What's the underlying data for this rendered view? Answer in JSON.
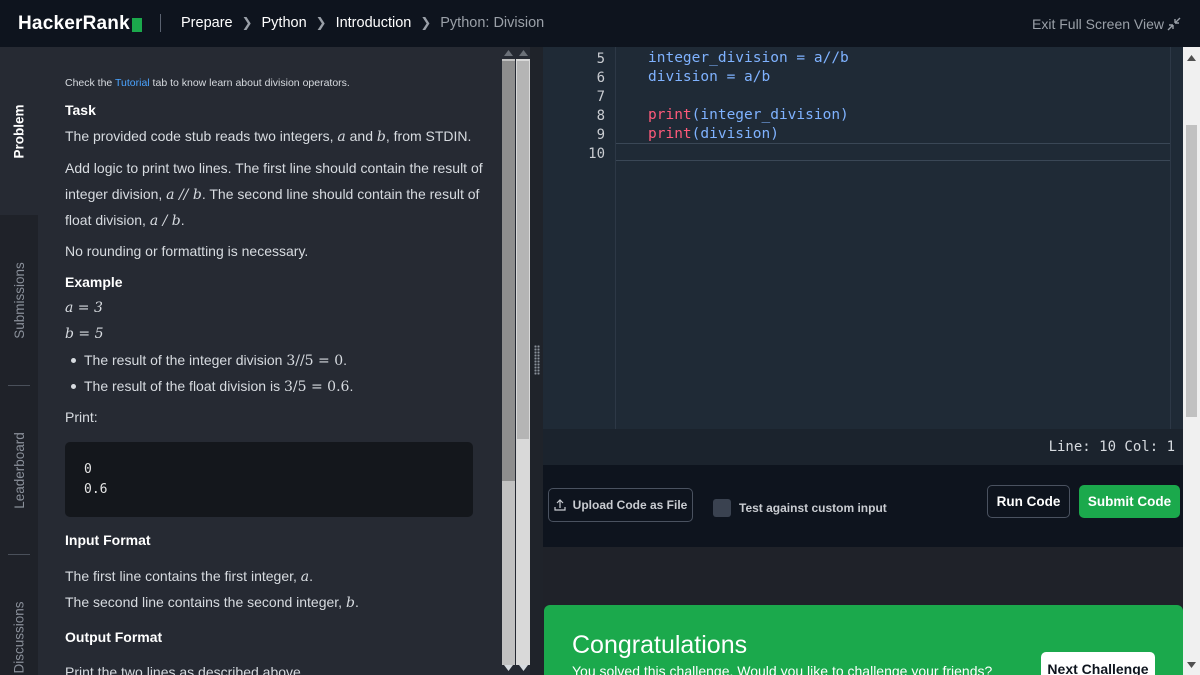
{
  "header": {
    "logo_text": "HackerRank",
    "breadcrumbs": [
      "Prepare",
      "Python",
      "Introduction",
      "Python: Division"
    ],
    "exit_fullscreen": "Exit Full Screen View"
  },
  "side_tabs": [
    "Problem",
    "Submissions",
    "Leaderboard",
    "Discussions"
  ],
  "problem": {
    "note_pre": "Check the ",
    "note_link": "Tutorial",
    "note_post": " tab to know learn about division operators.",
    "task_heading": "Task",
    "task_text_pre": "The provided code stub reads two integers, ",
    "var_a": "a",
    "task_and": " and ",
    "var_b": "b",
    "task_text_post": ", from STDIN.",
    "logic_line1": "Add logic to print two lines. The first line should contain the result of",
    "logic_line2_pre": "integer division, ",
    "int_div_expr": "a // b",
    "logic_line2_post": ". The second line should contain the result of",
    "logic_line3_pre": "float division, ",
    "float_div_expr": "a / b",
    "logic_line3_post": ".",
    "no_rounding": "No rounding or formatting is necessary.",
    "example_heading": "Example",
    "example_a": "a = 3",
    "example_b": "b = 5",
    "bullet1_pre": "The result of the integer division ",
    "bullet1_expr": "3//5 = 0",
    "bullet1_post": ".",
    "bullet2_pre": "The result of the float division is ",
    "bullet2_expr": "3/5 = 0.6",
    "bullet2_post": ".",
    "print_label": "Print:",
    "output_lines": [
      "0",
      "0.6"
    ],
    "input_heading": "Input Format",
    "input_line1_pre": "The first line contains the first integer, ",
    "input_line1_var": "a",
    "input_line1_post": ".",
    "input_line2_pre": "The second line contains the second integer, ",
    "input_line2_var": "b",
    "input_line2_post": ".",
    "output_heading": "Output Format",
    "output_text": "Print the two lines as described above."
  },
  "editor": {
    "line_numbers": [
      "5",
      "6",
      "7",
      "8",
      "9",
      "10"
    ],
    "line5": "integer_division = a//b",
    "line6": "division = a/b",
    "line8_kw": "print",
    "line8_rest": "(integer_division)",
    "line9_kw": "print",
    "line9_rest": "(division)",
    "status": "Line: 10 Col: 1"
  },
  "toolbar": {
    "upload_label": "Upload Code as File",
    "custom_input_label": "Test against custom input",
    "run_label": "Run Code",
    "submit_label": "Submit Code"
  },
  "result": {
    "title": "Congratulations",
    "subtitle": "You solved this challenge. Would you like to challenge your friends?",
    "next_label": "Next Challenge"
  },
  "colors": {
    "brand_green": "#1ba94c",
    "keyword": "#ff5a7a",
    "identifier": "#7fb2ff",
    "link": "#4aa3ff"
  }
}
